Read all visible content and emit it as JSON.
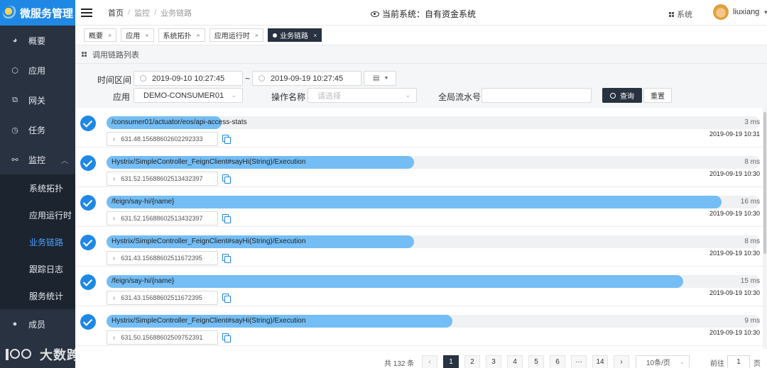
{
  "app": {
    "title": "微服务管理"
  },
  "sidebar": {
    "items": [
      {
        "label": "概要",
        "icon": "dashboard-icon"
      },
      {
        "label": "应用",
        "icon": "cube-icon"
      },
      {
        "label": "网关",
        "icon": "gateway-icon"
      },
      {
        "label": "任务",
        "icon": "clock-icon"
      },
      {
        "label": "监控",
        "icon": "monitor-icon",
        "expanded": true
      }
    ],
    "monitor_sub": [
      "系统拓扑",
      "应用运行时",
      "业务链路",
      "跟踪日志",
      "服务统计"
    ],
    "active_sub": "业务链路",
    "bottom_item": {
      "label": "成员",
      "icon": "user-icon"
    }
  },
  "header": {
    "breadcrumb": [
      "首页",
      "监控",
      "业务链路"
    ],
    "current_system": "当前系统：自有资金系统",
    "system_menu": "系统",
    "user": "liuxiang"
  },
  "tabs": [
    {
      "label": "概要",
      "active": false
    },
    {
      "label": "应用",
      "active": false
    },
    {
      "label": "系统拓扑",
      "active": false
    },
    {
      "label": "应用运行时",
      "active": false
    },
    {
      "label": "业务链路",
      "active": true
    }
  ],
  "panel": {
    "title": "调用链路列表"
  },
  "filters": {
    "time_label": "时间区间",
    "time_start": "2019-09-10 10:27:45",
    "time_sep": "~",
    "time_end": "2019-09-19 10:27:45",
    "app_label": "应用",
    "app_value": "DEMO-CONSUMER01",
    "op_label": "操作名称",
    "op_placeholder": "请选择",
    "flow_label": "全局流水号",
    "flow_value": "",
    "search_btn": "查询",
    "reset_btn": "重置"
  },
  "traces": [
    {
      "operation": "/consumer01/actuator/eos/api-access-stats",
      "duration": "3 ms",
      "duration_ms": 3,
      "time": "2019-09-19 10:31",
      "trace_id": "631.48.15688602602292333"
    },
    {
      "operation": "Hystrix/SimpleController_FeignClient#sayHi(String)/Execution",
      "duration": "8 ms",
      "duration_ms": 8,
      "time": "2019-09-19 10:30",
      "trace_id": "631.52.15688602513432397"
    },
    {
      "operation": "/feign/say-hi/{name}",
      "duration": "16 ms",
      "duration_ms": 16,
      "time": "2019-09-19 10:30",
      "trace_id": "631.52.15688602513432397"
    },
    {
      "operation": "Hystrix/SimpleController_FeignClient#sayHi(String)/Execution",
      "duration": "8 ms",
      "duration_ms": 8,
      "time": "2019-09-19 10:30",
      "trace_id": "631.43.15688602511672395"
    },
    {
      "operation": "/feign/say-hi/{name}",
      "duration": "15 ms",
      "duration_ms": 15,
      "time": "2019-09-19 10:30",
      "trace_id": "631.43.15688602511672395"
    },
    {
      "operation": "Hystrix/SimpleController_FeignClient#sayHi(String)/Execution",
      "duration": "9 ms",
      "duration_ms": 9,
      "time": "2019-09-19 10:30",
      "trace_id": "631.50.15688602509752391"
    }
  ],
  "max_duration_ms": 17,
  "pagination": {
    "total": "共 132 条",
    "pages": [
      "1",
      "2",
      "3",
      "4",
      "5",
      "6",
      "···",
      "14"
    ],
    "current": "1",
    "page_size": "10条/页",
    "goto_label": "前往",
    "goto_value": "1",
    "page_suffix": "页"
  },
  "watermark": "大数跨境",
  "colors": {
    "sidebar": "#283240",
    "accent": "#1f88e5",
    "bar": "#74bdf5"
  }
}
